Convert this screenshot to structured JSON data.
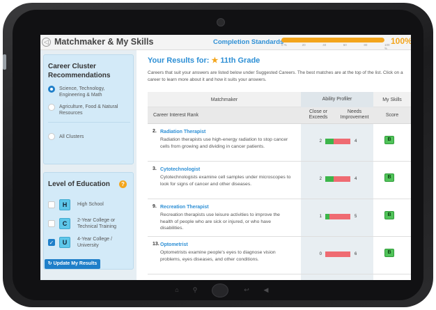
{
  "header": {
    "app_title": "Matchmaker & My Skills",
    "completion_label": "Completion Standards",
    "completion_value": 100,
    "completion_pct": "100%",
    "ticks": [
      "0 %",
      "20",
      "40",
      "60",
      "80",
      "100 %"
    ]
  },
  "sidebar": {
    "cluster_title_line1": "Career Cluster",
    "cluster_title_line2": "Recommendations",
    "clusters": [
      {
        "line1": "Science, Technology,",
        "line2": "Engineering & Math",
        "selected": true
      },
      {
        "line1": "Agriculture, Food & Natural",
        "line2": "Resources",
        "selected": false
      },
      {
        "line1": "All Clusters",
        "line2": "",
        "selected": false
      }
    ],
    "education_title": "Level of Education",
    "education_info": "?",
    "education_levels": [
      {
        "letter": "H",
        "line1": "High School",
        "line2": "",
        "checked": false
      },
      {
        "letter": "C",
        "line1": "2-Year College or",
        "line2": "Technical Training",
        "checked": false
      },
      {
        "letter": "U",
        "line1": "4-Year College /",
        "line2": "University",
        "checked": true
      }
    ],
    "update_button": "Update My Results",
    "update_icon": "refresh-icon"
  },
  "main": {
    "results_label": "Your Results for:",
    "grade": "11th Grade",
    "star": "★",
    "intro": "Careers that suit your answers are listed below under Suggested Careers. The best matches are at the top of the list. Click on a career to learn more about it and how it suits your answers.",
    "table_headers": {
      "matchmaker": "Matchmaker",
      "ability_profiler": "Ability Profiler",
      "my_skills": "My Skills",
      "career_interest_rank": "Career Interest Rank",
      "close_or_exceeds_line1": "Close or",
      "close_or_exceeds_line2": "Exceeds",
      "needs_improvement_line1": "Needs",
      "needs_improvement_line2": "Improvement",
      "score": "Score"
    },
    "careers": [
      {
        "rank": "2.",
        "name": "Radiation Therapist",
        "desc": "Radiation therapists use high-energy radiation to stop cancer cells from growing and dividing in cancer patients.",
        "close": 2,
        "needs": 4,
        "score": "B"
      },
      {
        "rank": "3.",
        "name": "Cytotechnologist",
        "desc": "Cytotechnologists examine cell samples under microscopes to look for signs of cancer and other diseases.",
        "close": 2,
        "needs": 4,
        "score": "B"
      },
      {
        "rank": "9.",
        "name": "Recreation Therapist",
        "desc": "Recreation therapists use leisure activities to improve the health of people who are sick or injured, or who have disabilities.",
        "close": 1,
        "needs": 5,
        "score": "B"
      },
      {
        "rank": "13.",
        "name": "Optometrist",
        "desc": "Optometrists examine people's eyes to diagnose vision problems, eyes diseases, and other conditions.",
        "close": 0,
        "needs": 6,
        "score": "B"
      }
    ]
  },
  "colors": {
    "accent": "#2d8fd5",
    "progress": "#f3a51c",
    "bar_green": "#3cb54a",
    "bar_red": "#ef6b72",
    "score_green": "#51c35a"
  }
}
